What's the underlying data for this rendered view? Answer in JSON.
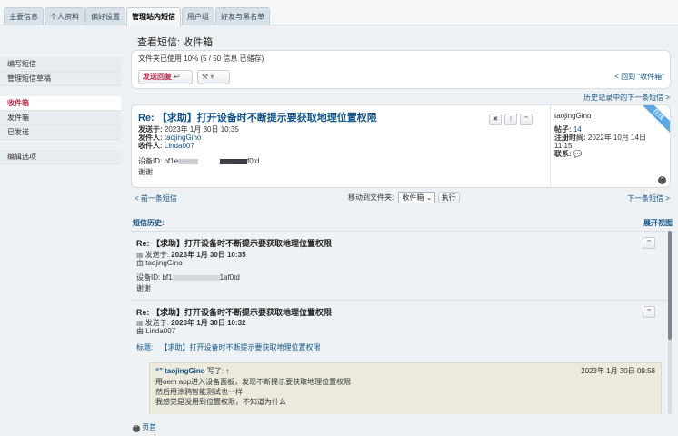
{
  "tabs": [
    "主要信息",
    "个人资料",
    "偏好设置",
    "管理站内短信",
    "用户组",
    "好友与黑名单"
  ],
  "page_title": "查看短信: 收件箱",
  "sidebar": {
    "compose": "编写短信",
    "drafts": "管理短信草稿",
    "inbox": "收件箱",
    "outbox": "发件箱",
    "sent": "已发送",
    "options": "编辑选项"
  },
  "folder_status": "文件夹已使用 10% (5 / 50 信息 已储存)",
  "reply_button": "发送回复",
  "back_link": "< 回到 \"收件箱\"",
  "next_history": "历史记录中的下一条短信 >",
  "message": {
    "title": "Re: 【求助】打开设备时不断提示要获取地理位置权限",
    "sent_label": "发送于:",
    "sent_value": "2023年 1月 30日 10:35",
    "from_label": "发件人:",
    "from_value": "taojingGino",
    "to_label": "收件人:",
    "to_value": "Linda007",
    "body_prefix": "设备ID: bf1e",
    "body_suffix": "f0td",
    "body_line2": "谢谢"
  },
  "profile": {
    "username": "taojingGino",
    "posts_label": "帖子:",
    "posts_value": "14",
    "joined_label": "注册时间:",
    "joined_value": "2022年 10月 14日 11:15",
    "contact_label": "联系:",
    "online_badge": "在线"
  },
  "nav": {
    "prev": "< 前一条短信",
    "move_label": "移动到文件夹:",
    "folder_option": "收件箱",
    "go_button": "执行",
    "next": "下一条短信 >"
  },
  "history_label": "短信历史:",
  "expand_view": "展开视图",
  "history": [
    {
      "title": "Re: 【求助】打开设备时不断提示要获取地理位置权限",
      "sent_label": "发送于:",
      "sent_value": "2023年 1月 30日 10:35",
      "by_label": "由",
      "by_value": "taojingGino",
      "body_prefix": "设备ID: bf1",
      "body_suffix": "1af0td",
      "body_line2": "谢谢"
    },
    {
      "title": "Re: 【求助】打开设备时不断提示要获取地理位置权限",
      "sent_label": "发送于:",
      "sent_value": "2023年 1月 30日 10:32",
      "by_label": "由",
      "by_value": "Linda007",
      "subject_label": "标题:",
      "subject_value": "【求助】打开设备时不断提示要获取地理位置权限",
      "quote_author": "taojingGino",
      "quote_wrote": "写了:",
      "quote_date": "2023年 1月 30日 09:58",
      "quote_lines": [
        "用oem app进入设备面板，发现不断提示要获取地理位置权限",
        "然后用涂鸦智能测试也一样",
        "我感觉是没用到位置权限，不知道为什么"
      ]
    }
  ],
  "top_link": "页首"
}
